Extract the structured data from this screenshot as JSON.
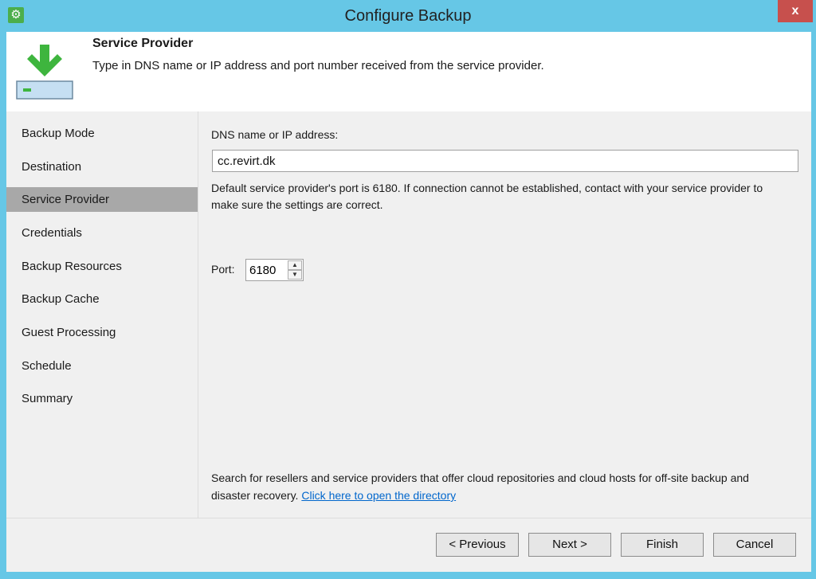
{
  "window": {
    "title": "Configure Backup",
    "close_label": "x",
    "app_icon": "gear-icon"
  },
  "header": {
    "title": "Service Provider",
    "description": "Type in DNS name or IP address and port number received from the service provider.",
    "icon": "download-arrow-icon"
  },
  "sidebar": {
    "items": [
      {
        "label": "Backup Mode"
      },
      {
        "label": "Destination"
      },
      {
        "label": "Service Provider",
        "active": true
      },
      {
        "label": "Credentials"
      },
      {
        "label": "Backup Resources"
      },
      {
        "label": "Backup Cache"
      },
      {
        "label": "Guest Processing"
      },
      {
        "label": "Schedule"
      },
      {
        "label": "Summary"
      }
    ]
  },
  "form": {
    "dns_label": "DNS name or IP address:",
    "dns_value": "cc.revirt.dk",
    "info_text": "Default service provider's port is 6180. If connection cannot be established, contact with your service provider to make sure the settings are correct.",
    "port_label": "Port:",
    "port_value": "6180"
  },
  "search": {
    "text": "Search for resellers and service providers that offer cloud repositories and cloud hosts for off-site backup and disaster recovery.",
    "link_text": "Click here to open the directory"
  },
  "buttons": {
    "previous": "< Previous",
    "next": "Next >",
    "finish": "Finish",
    "cancel": "Cancel"
  },
  "colors": {
    "titlebar": "#66c7e6",
    "close": "#c7504d",
    "active_nav": "#a8a8a8",
    "link": "#0066cc"
  }
}
